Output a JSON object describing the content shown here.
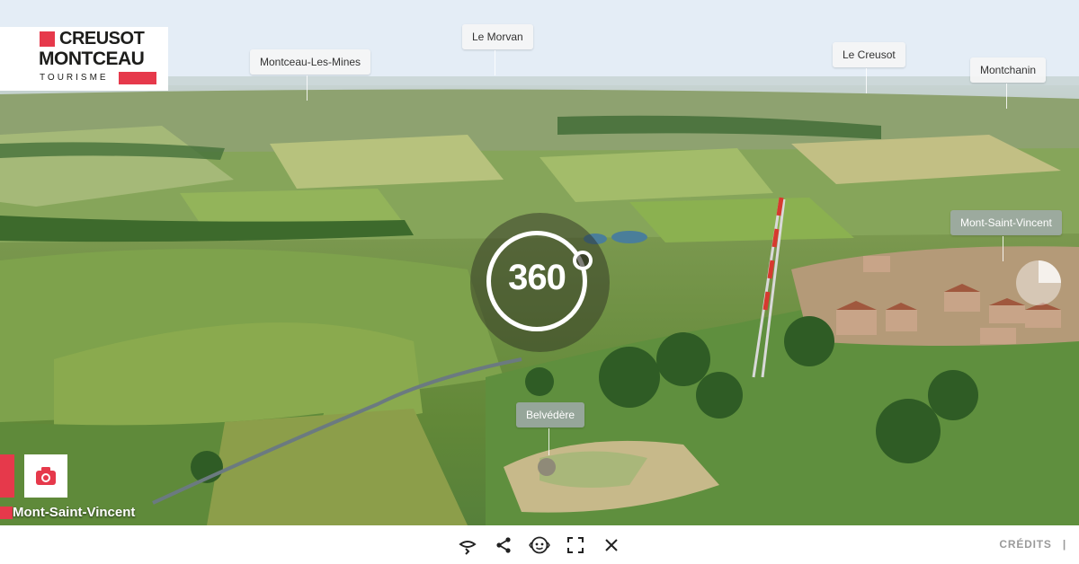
{
  "logo": {
    "line1": "CREUSOT",
    "line2": "MONTCEAU",
    "line3": "TOURISME"
  },
  "hotspots": {
    "montceau": "Montceau-Les-Mines",
    "morvan": "Le Morvan",
    "creusot": "Le Creusot",
    "montchanin": "Montchanin",
    "msv": "Mont-Saint-Vincent",
    "belvedere": "Belvédère"
  },
  "badge": {
    "label": "360"
  },
  "location": {
    "name": "Mont-Saint-Vincent"
  },
  "toolbar": {
    "icons": [
      "rotate-icon",
      "share-icon",
      "gyroscope-icon",
      "fullscreen-icon",
      "close-icon"
    ],
    "credits_label": "CRÉDITS",
    "separator": "|"
  },
  "colors": {
    "brand_red": "#e6394b",
    "toolbar_bg": "#ffffff",
    "credits_grey": "#9a9a9a"
  }
}
